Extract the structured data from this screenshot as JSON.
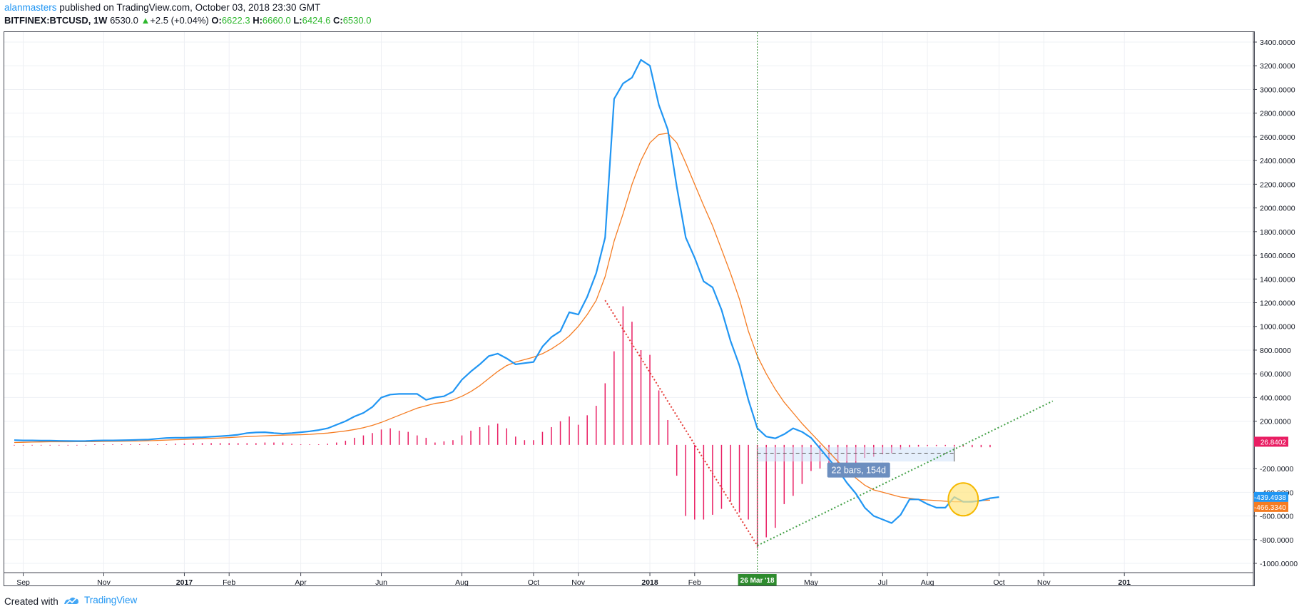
{
  "header": {
    "user": "alanmasters",
    "published": " published on TradingView.com, October 03, 2018 23:30 GMT",
    "symbol": "BITFINEX:BTCUSD, 1W",
    "last": "6530.0",
    "change_arrow": "▲",
    "change": "+2.5 (+0.04%)",
    "o_label": "O:",
    "o_val": "6622.3",
    "h_label": "H:",
    "h_val": "6660.0",
    "l_label": "L:",
    "l_val": "6424.6",
    "c_label": "C:",
    "c_val": "6530.0"
  },
  "footer": {
    "created": "Created with",
    "brand": "TradingView",
    "logo_icon": "tradingview-logo-icon"
  },
  "colors": {
    "fast": "#2196f3",
    "slow": "#f57c22",
    "hist": "#e91e63",
    "grid": "#eef0f4",
    "trend_red": "#e53935",
    "trend_green": "#43a047",
    "crosshair": "#2e8b2e"
  },
  "chart_data": {
    "type": "line",
    "title": "",
    "xlabel": "",
    "ylabel": "",
    "ylim": [
      -1000,
      3400
    ],
    "y_ticks": [
      "3400.0000",
      "3200.0000",
      "3000.0000",
      "2800.0000",
      "2600.0000",
      "2400.0000",
      "2200.0000",
      "2000.0000",
      "1800.0000",
      "1600.0000",
      "1400.0000",
      "1200.0000",
      "1000.0000",
      "800.0000",
      "600.0000",
      "400.0000",
      "200.0000",
      "-200.0000",
      "-400.0000",
      "-600.0000",
      "-800.0000",
      "-1000.0000"
    ],
    "x_ticks": [
      {
        "label": "Sep",
        "i": 1
      },
      {
        "label": "Nov",
        "i": 10
      },
      {
        "label": "2017",
        "i": 19
      },
      {
        "label": "Feb",
        "i": 24
      },
      {
        "label": "Apr",
        "i": 32
      },
      {
        "label": "Jun",
        "i": 41
      },
      {
        "label": "Aug",
        "i": 50
      },
      {
        "label": "Oct",
        "i": 58
      },
      {
        "label": "Nov",
        "i": 63
      },
      {
        "label": "2018",
        "i": 71
      },
      {
        "label": "Feb",
        "i": 76
      },
      {
        "label": "May",
        "i": 89
      },
      {
        "label": "Jul",
        "i": 97
      },
      {
        "label": "Aug",
        "i": 102
      },
      {
        "label": "Oct",
        "i": 110
      },
      {
        "label": "Nov",
        "i": 115
      },
      {
        "label": "201",
        "i": 124
      }
    ],
    "crosshair": {
      "label": "26 Mar '18",
      "i": 83
    },
    "series": [
      {
        "name": "",
        "values": [
          40,
          38,
          38,
          36,
          36,
          34,
          33,
          32,
          33,
          36,
          38,
          38,
          39,
          41,
          43,
          45,
          52,
          58,
          60,
          60,
          63,
          65,
          69,
          73,
          78,
          86,
          100,
          105,
          107,
          100,
          95,
          100,
          107,
          115,
          125,
          140,
          170,
          200,
          240,
          270,
          320,
          400,
          425,
          430,
          430,
          430,
          380,
          400,
          410,
          450,
          550,
          620,
          680,
          750,
          770,
          730,
          680,
          690,
          700,
          830,
          910,
          960,
          1120,
          1100,
          1250,
          1450,
          1750,
          2920,
          3050,
          3100,
          3250,
          3200,
          2870,
          2660,
          2180,
          1750,
          1580,
          1380,
          1330,
          1140,
          880,
          670,
          380,
          140,
          70,
          55,
          90,
          140,
          110,
          60,
          -30,
          -120,
          -210,
          -320,
          -410,
          -530,
          -600,
          -630,
          -660,
          -590,
          -460,
          -460,
          -500,
          -530,
          -530,
          -440,
          -480,
          -480,
          -470,
          -450,
          -440
        ]
      },
      {
        "name": "",
        "values": [
          20,
          22,
          24,
          25,
          26,
          26,
          26,
          27,
          27,
          28,
          29,
          30,
          31,
          32,
          33,
          35,
          38,
          41,
          44,
          46,
          49,
          52,
          55,
          58,
          62,
          66,
          70,
          74,
          77,
          80,
          82,
          84,
          86,
          89,
          94,
          100,
          108,
          118,
          130,
          145,
          165,
          190,
          220,
          250,
          280,
          310,
          330,
          350,
          360,
          380,
          410,
          450,
          500,
          560,
          620,
          670,
          700,
          720,
          740,
          770,
          810,
          860,
          920,
          1000,
          1100,
          1220,
          1420,
          1720,
          1950,
          2200,
          2400,
          2550,
          2620,
          2630,
          2550,
          2380,
          2200,
          2020,
          1850,
          1650,
          1450,
          1230,
          960,
          750,
          600,
          470,
          360,
          270,
          180,
          100,
          20,
          -60,
          -140,
          -210,
          -280,
          -340,
          -380,
          -400,
          -420,
          -440,
          -450,
          -460,
          -465,
          -470,
          -475,
          -480,
          -480,
          -475,
          -470,
          -466
        ]
      },
      {
        "name": "",
        "values": [
          -5,
          -5,
          -5,
          -5,
          -5,
          -5,
          -5,
          -5,
          -5,
          5,
          5,
          5,
          5,
          5,
          5,
          5,
          5,
          5,
          10,
          10,
          15,
          15,
          15,
          15,
          15,
          15,
          15,
          15,
          20,
          20,
          20,
          10,
          5,
          5,
          5,
          10,
          20,
          35,
          60,
          80,
          100,
          130,
          140,
          120,
          110,
          80,
          60,
          20,
          30,
          40,
          80,
          120,
          150,
          165,
          180,
          140,
          70,
          40,
          40,
          110,
          150,
          200,
          240,
          170,
          250,
          330,
          520,
          790,
          1170,
          1040,
          800,
          760,
          460,
          210,
          -260,
          -600,
          -630,
          -630,
          -590,
          -540,
          -480,
          -570,
          -630,
          -870,
          -780,
          -700,
          -500,
          -430,
          -330,
          -220,
          -200,
          -180,
          -170,
          -150,
          -150,
          -110,
          -100,
          -80,
          -70,
          -40,
          -20,
          -15,
          -10,
          -10,
          -10,
          -15,
          -15,
          -20,
          -20,
          -20
        ]
      }
    ],
    "last_values": {
      "hist": "26.8402",
      "fast": "-439.4938",
      "slow": "-466.3340"
    },
    "measure_label": "22 bars, 154d"
  }
}
